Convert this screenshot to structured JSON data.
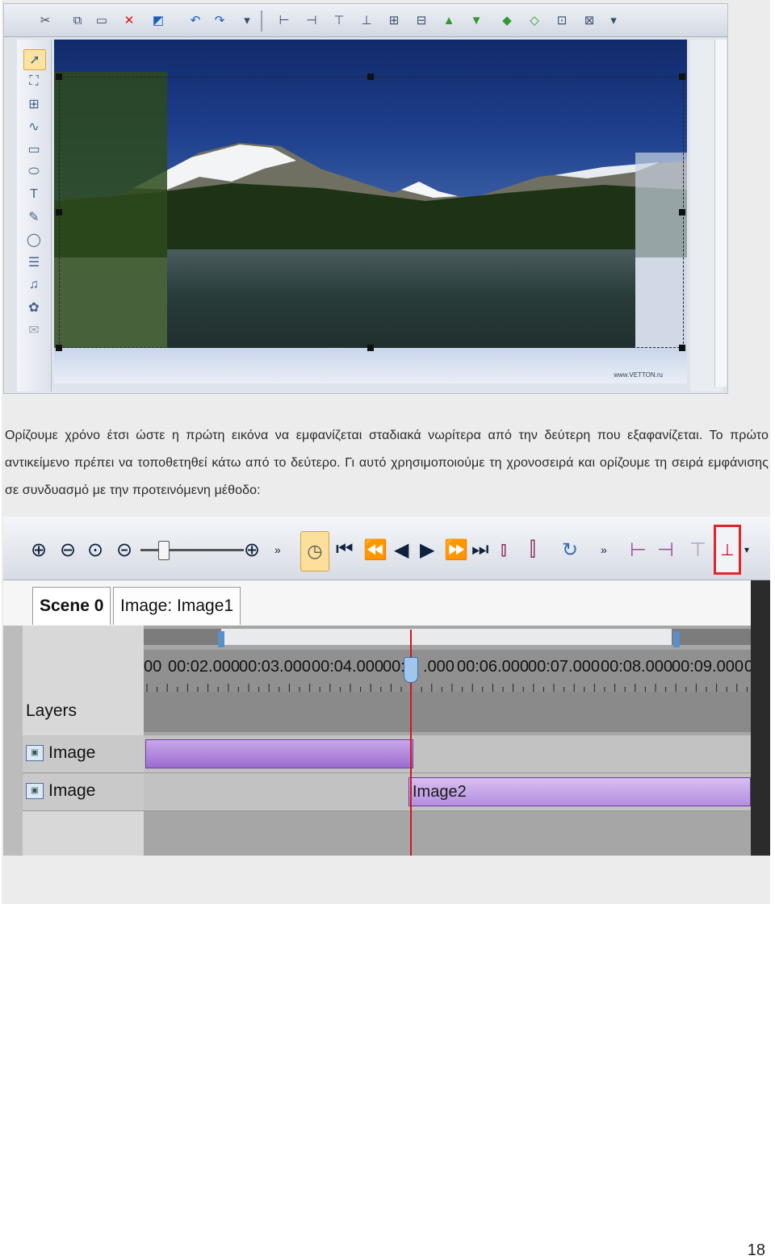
{
  "paragraph": "Ορίζουμε χρόνο έτσι ώστε η πρώτη εικόνα να εμφανίζεται σταδιακά νωρίτερα από την δεύτερη που εξαφανίζεται. Το πρώτο αντικείμενο πρέπει να τοποθετηθεί κάτω από το δεύτερο. Γι αυτό χρησιμοποιούμε τη χρονοσειρά και ορίζουμε τη σειρά εμφάνισης σε συνδυασμό με την προτεινόμενη μέθοδο:",
  "editor": {
    "watermark": "www.VETTON.ru",
    "toolbar_icons": [
      "cut-icon",
      "copy-icon",
      "delete-icon",
      "save-icon",
      "undo-icon",
      "redo-icon",
      "align-left-icon",
      "align-center-icon",
      "align-right-icon",
      "distribute-icon",
      "move-up-icon",
      "move-down-icon",
      "bring-forward-icon",
      "send-backward-icon",
      "group-icon"
    ],
    "left_tools": [
      "pointer-icon",
      "crop-icon",
      "transform-icon",
      "curve-icon",
      "rectangle-icon",
      "ellipse-icon",
      "text-icon",
      "highlight-icon",
      "circle-icon",
      "subtitles-icon",
      "music-icon",
      "effects-icon",
      "chat-icon"
    ]
  },
  "timeline": {
    "tabs": [
      "Scene 0",
      "Image: Image1"
    ],
    "ruler_labels": [
      "00",
      "00:02.000",
      "00:03.000",
      "00:04.000",
      "00:",
      ".000",
      "00:06.000",
      "00:07.000",
      "00:08.000",
      "00:09.000",
      "0"
    ],
    "layers_label": "Layers",
    "rows": [
      {
        "label": "Image",
        "clip_label": ""
      },
      {
        "label": "Image",
        "clip_label": "Image2"
      }
    ],
    "accent": "#e0262b",
    "clip_color": "#a97ddb"
  },
  "page_number": "18"
}
